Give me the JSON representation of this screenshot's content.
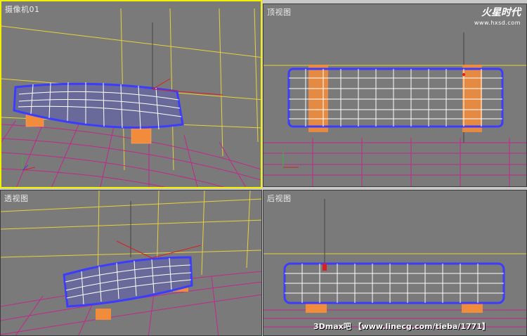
{
  "viewports": {
    "camera": {
      "label": "摄像机01"
    },
    "top": {
      "label": "顶视图"
    },
    "perspective": {
      "label": "透视图"
    },
    "back": {
      "label": "后视图"
    }
  },
  "logo": {
    "text": "火星时代",
    "url": "www.hxsd.com"
  },
  "watermark": {
    "text": "3Dmax吧 【www.linecg.com/tieba/1771】"
  },
  "colors": {
    "viewport_bg": "#7a7a7a",
    "active_border": "#f0f000",
    "grid_magenta": "#c0288c",
    "grid_yellow": "#e6d23c",
    "mesh_blue": "#3c3cff",
    "mesh_white": "#ffffff",
    "leg_orange": "#f08c3c",
    "gizmo_red": "#dc1e1e"
  }
}
